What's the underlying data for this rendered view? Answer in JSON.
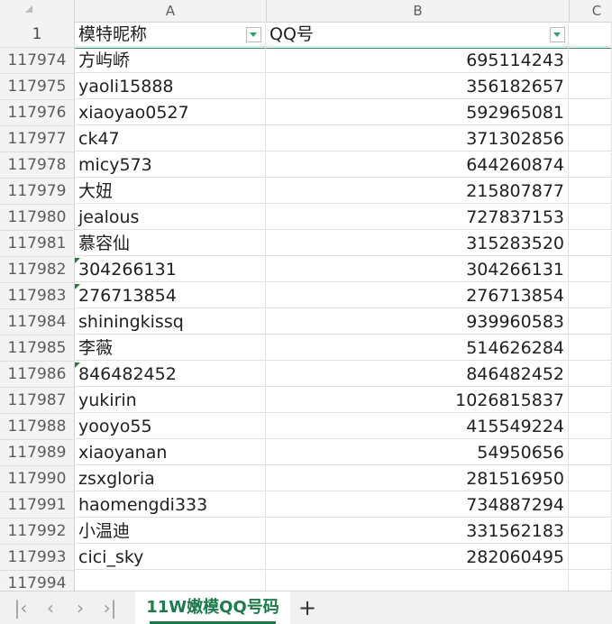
{
  "columns": {
    "a": "A",
    "b": "B",
    "c": "C"
  },
  "header": {
    "row_number": "1",
    "col_a": "模特昵称",
    "col_b": "QQ号"
  },
  "rows": [
    {
      "n": "117974",
      "name": "方屿峤",
      "qq": "695114243",
      "text_flag": false
    },
    {
      "n": "117975",
      "name": "yaoli15888",
      "qq": "356182657",
      "text_flag": false
    },
    {
      "n": "117976",
      "name": "xiaoyao0527",
      "qq": "592965081",
      "text_flag": false
    },
    {
      "n": "117977",
      "name": "ck47",
      "qq": "371302856",
      "text_flag": false
    },
    {
      "n": "117978",
      "name": "micy573",
      "qq": "644260874",
      "text_flag": false
    },
    {
      "n": "117979",
      "name": "大妞",
      "qq": "215807877",
      "text_flag": false
    },
    {
      "n": "117980",
      "name": "jealous",
      "qq": "727837153",
      "text_flag": false
    },
    {
      "n": "117981",
      "name": "慕容仙",
      "qq": "315283520",
      "text_flag": false
    },
    {
      "n": "117982",
      "name": "304266131",
      "qq": "304266131",
      "text_flag": true
    },
    {
      "n": "117983",
      "name": "276713854",
      "qq": "276713854",
      "text_flag": true
    },
    {
      "n": "117984",
      "name": "shiningkissq",
      "qq": "939960583",
      "text_flag": false
    },
    {
      "n": "117985",
      "name": "李薇",
      "qq": "514626284",
      "text_flag": false
    },
    {
      "n": "117986",
      "name": "846482452",
      "qq": "846482452",
      "text_flag": true
    },
    {
      "n": "117987",
      "name": "yukirin",
      "qq": "1026815837",
      "text_flag": false
    },
    {
      "n": "117988",
      "name": "yooyo55",
      "qq": "415549224",
      "text_flag": false
    },
    {
      "n": "117989",
      "name": "xiaoyanan",
      "qq": "54950656",
      "text_flag": false
    },
    {
      "n": "117990",
      "name": "zsxgloria",
      "qq": "281516950",
      "text_flag": false
    },
    {
      "n": "117991",
      "name": "haomengdi333",
      "qq": "734887294",
      "text_flag": false
    },
    {
      "n": "117992",
      "name": "小温迪",
      "qq": "331562183",
      "text_flag": false
    },
    {
      "n": "117993",
      "name": "cici_sky",
      "qq": "282060495",
      "text_flag": false
    },
    {
      "n": "117994",
      "name": "",
      "qq": "",
      "text_flag": false
    }
  ],
  "tabs": {
    "first_icon": "first-sheet-icon",
    "prev_icon": "previous-sheet-icon",
    "next_icon": "next-sheet-icon",
    "last_icon": "last-sheet-icon",
    "active_sheet": "11W嫩模QQ号码",
    "add_icon": "add-sheet-icon"
  },
  "colors": {
    "accent": "#1d7a4a",
    "filter_arrow": "#2e9e6b"
  }
}
